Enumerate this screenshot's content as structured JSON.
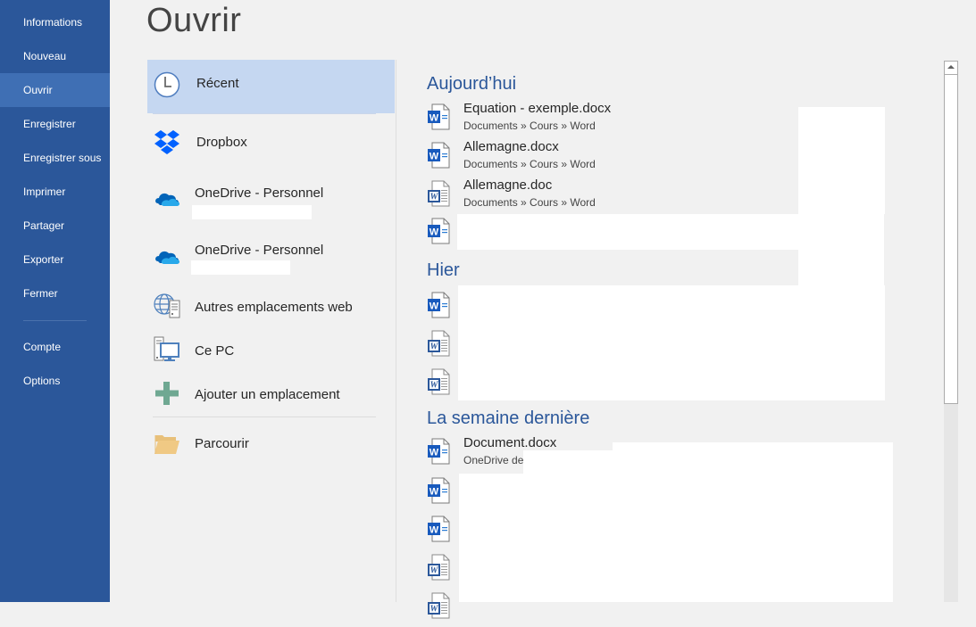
{
  "sidebar": {
    "items": [
      {
        "label": "Informations"
      },
      {
        "label": "Nouveau"
      },
      {
        "label": "Ouvrir",
        "active": true
      },
      {
        "label": "Enregistrer"
      },
      {
        "label": "Enregistrer sous"
      },
      {
        "label": "Imprimer"
      },
      {
        "label": "Partager"
      },
      {
        "label": "Exporter"
      },
      {
        "label": "Fermer"
      }
    ],
    "bottom_items": [
      {
        "label": "Compte"
      },
      {
        "label": "Options"
      }
    ],
    "colors": {
      "background": "#2b579a",
      "active": "#3f6fb4"
    }
  },
  "page": {
    "title": "Ouvrir"
  },
  "places": [
    {
      "label": "Récent",
      "icon": "clock-icon",
      "active": true
    },
    {
      "label": "Dropbox",
      "icon": "dropbox-icon"
    },
    {
      "label": "OneDrive - Personnel",
      "icon": "onedrive-icon",
      "sublabel": "[redacted]"
    },
    {
      "label": "OneDrive - Personnel",
      "icon": "onedrive-icon",
      "sublabel": "[redacted]"
    },
    {
      "label": "Autres emplacements web",
      "icon": "globe-server-icon"
    },
    {
      "label": "Ce PC",
      "icon": "computer-icon"
    },
    {
      "label": "Ajouter un emplacement",
      "icon": "plus-icon"
    },
    {
      "label": "Parcourir",
      "icon": "folder-icon"
    }
  ],
  "recent": {
    "sections": [
      {
        "heading": "Aujourd’hui",
        "files": [
          {
            "name": "Equation - exemple.docx",
            "path": "Documents » Cours » Word",
            "icon": "word-docx-icon"
          },
          {
            "name": "Allemagne.docx",
            "path": "Documents » Cours » Word",
            "icon": "word-docx-icon"
          },
          {
            "name": "Allemagne.doc",
            "path": "Documents » Cours » Word",
            "icon": "word-doc-icon"
          },
          {
            "name": "[redacted]",
            "path": "",
            "icon": "word-docx-icon"
          }
        ]
      },
      {
        "heading": "Hier",
        "files": [
          {
            "name": "[redacted]",
            "path": "",
            "icon": "word-docx-icon"
          },
          {
            "name": "[redacted]",
            "path": "",
            "icon": "word-doc-icon"
          },
          {
            "name": "[redacted]",
            "path": "",
            "icon": "word-doc-icon"
          }
        ]
      },
      {
        "heading": "La semaine dernière",
        "files": [
          {
            "name": "Document.docx",
            "path": "OneDrive de",
            "icon": "word-docx-icon"
          },
          {
            "name": "[redacted]",
            "path": "",
            "icon": "word-docx-icon"
          },
          {
            "name": "[redacted]",
            "path": "",
            "icon": "word-docx-icon"
          },
          {
            "name": "[redacted]",
            "path": "",
            "icon": "word-doc-icon"
          },
          {
            "name": "[redacted]",
            "path": "",
            "icon": "word-doc-icon"
          }
        ]
      }
    ],
    "heading_color": "#2b579a"
  }
}
